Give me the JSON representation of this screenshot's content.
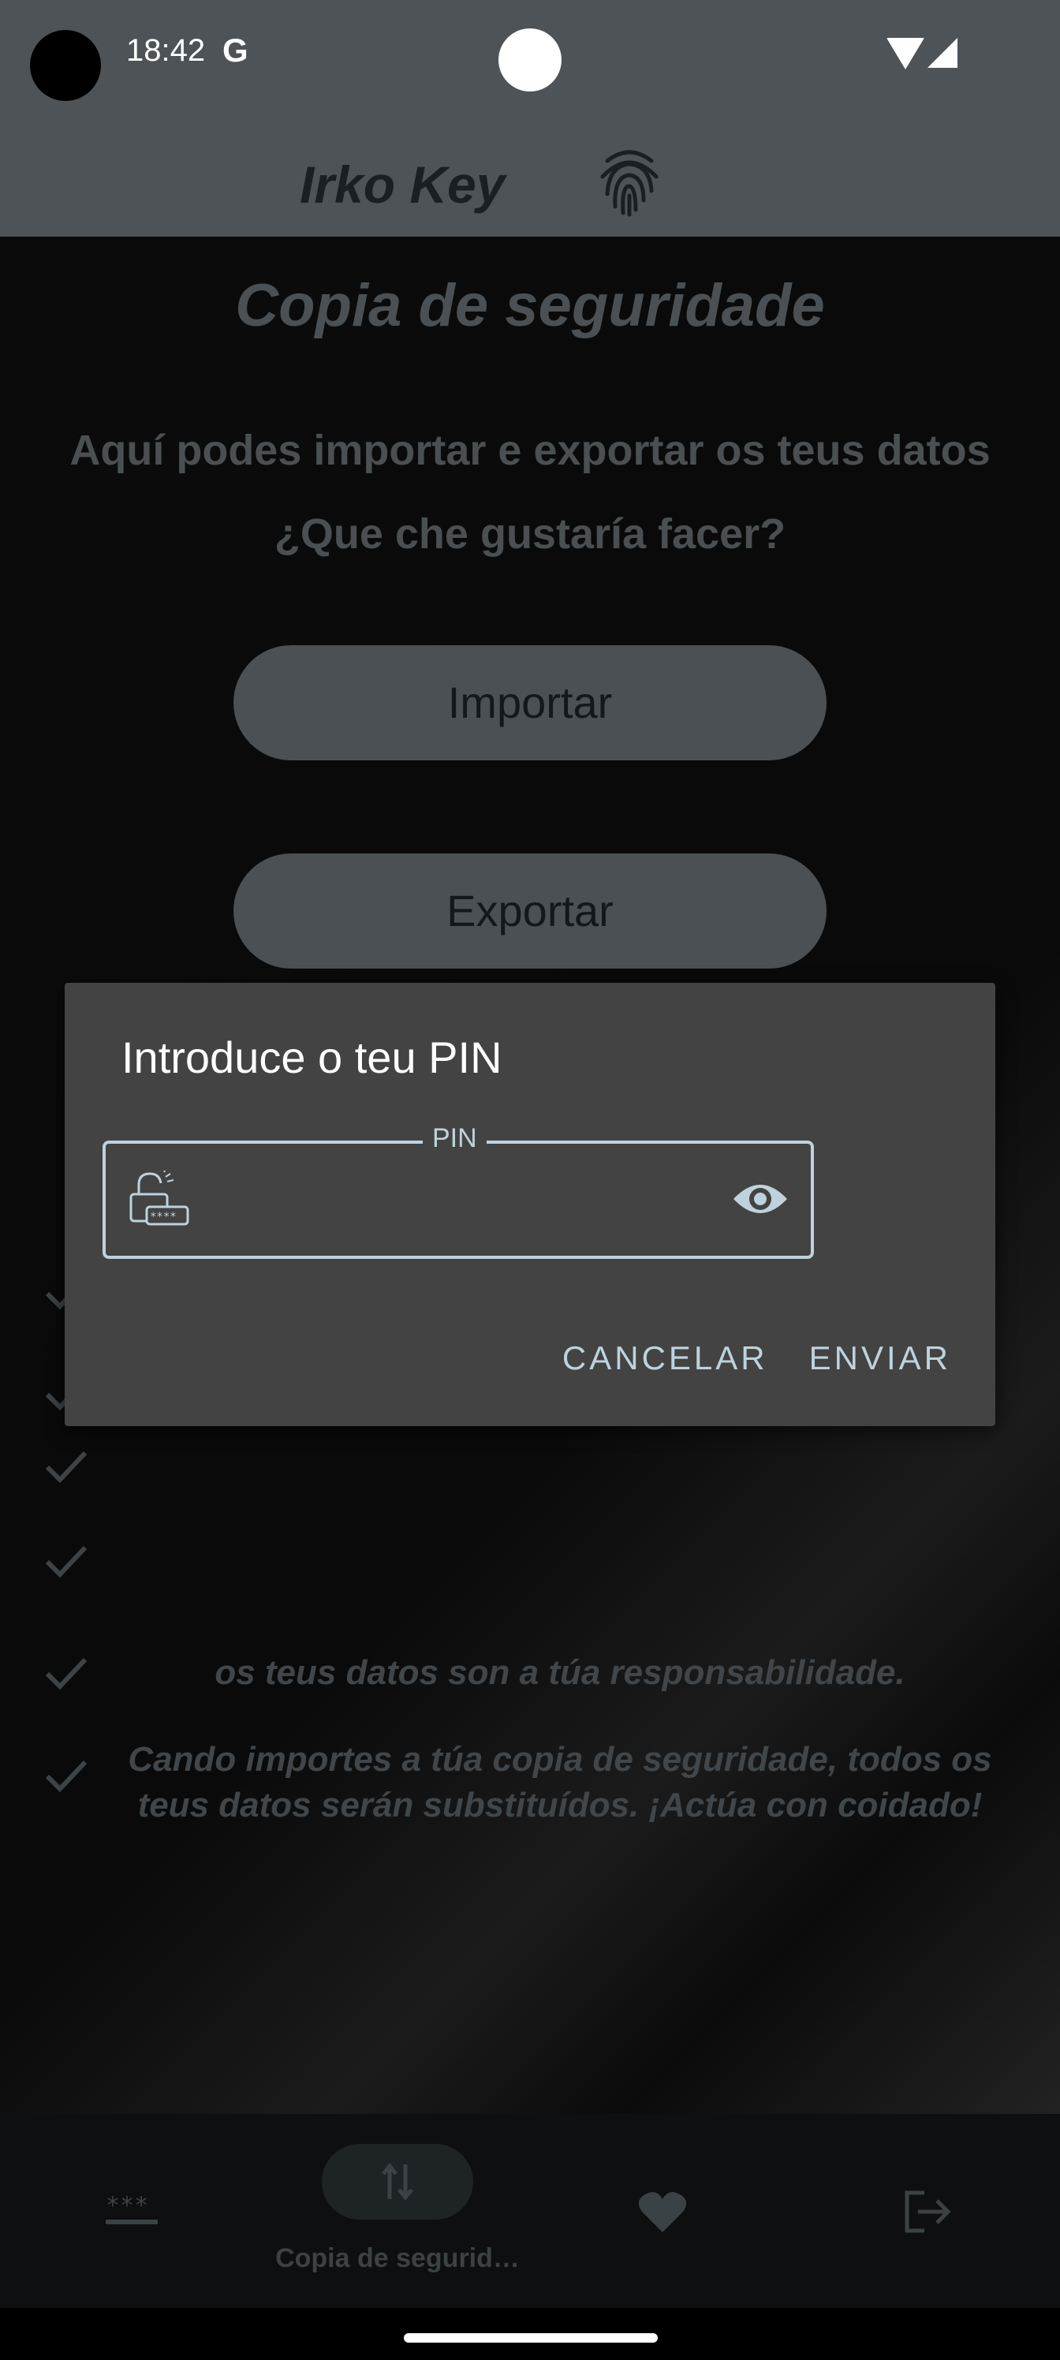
{
  "status_bar": {
    "time": "18:42",
    "google_icon": "G"
  },
  "app_bar": {
    "title": "Irko Key",
    "icon": "fingerprint-icon"
  },
  "main": {
    "title": "Copia de seguridade",
    "intro_line1": "Aquí podes importar e exportar os teus datos",
    "intro_line2": "¿Que che gustaría facer?",
    "import_button": "Importar",
    "export_button": "Exportar",
    "bullets": [
      {
        "text": "os teus datos son a túa responsabilidade."
      },
      {
        "text": "Cando importes a túa copia de seguridade, todos os teus datos serán substituídos. ¡Actúa con coidado!"
      }
    ]
  },
  "dialog": {
    "title": "Introduce o teu PIN",
    "field_label": "PIN",
    "field_value": "",
    "cancel": "CANCELAR",
    "submit": "ENVIAR"
  },
  "nav": {
    "items": [
      {
        "icon": "password-icon",
        "label": ""
      },
      {
        "icon": "swap-vertical-icon",
        "label": "Copia de segurid…"
      },
      {
        "icon": "heart-icon",
        "label": ""
      },
      {
        "icon": "logout-icon",
        "label": ""
      }
    ]
  },
  "colors": {
    "surface": "#4d5357",
    "dialog": "#434343",
    "accent": "#bfd2dc"
  }
}
